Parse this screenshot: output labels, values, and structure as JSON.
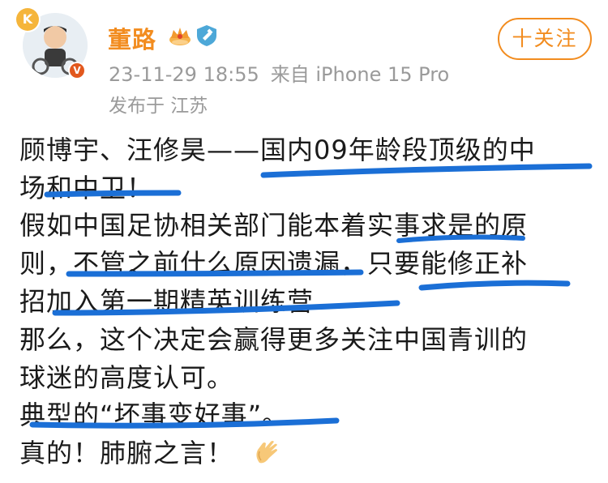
{
  "post": {
    "author": "董路",
    "follow_label": "十关注",
    "timestamp": "23-11-29 18:55",
    "source": "来自 iPhone 15 Pro",
    "location": "发布于 江苏",
    "lines": [
      "顾博宇、汪修昊——国内09年龄段顶级的中",
      "场和中卫！",
      "假如中国足协相关部门能本着实事求是的原",
      "则，不管之前什么原因遗漏，只要能修正补",
      "招加入第一期精英训练营",
      "那么，这个决定会赢得更多关注中国青训的",
      "球迷的高度认可。",
      "典型的“坏事变好事”。",
      "真的！肺腑之言！"
    ]
  },
  "avatar_badge": "K",
  "verify_badge": "V",
  "icons": {
    "crown": "crown-icon",
    "gov": "gov-badge-icon",
    "clap": "clap-emoji-icon"
  },
  "colors": {
    "username": "#f28c1f",
    "highlight": "#1b6fd6",
    "meta": "#9a9a9a"
  }
}
